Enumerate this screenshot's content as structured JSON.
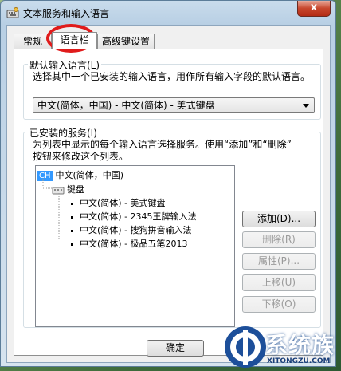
{
  "window": {
    "title": "文本服务和输入语言",
    "close_label": "x"
  },
  "tabs": [
    {
      "label": "常规"
    },
    {
      "label": "语言栏"
    },
    {
      "label": "高级键设置"
    }
  ],
  "default_group": {
    "label": "默认输入语言(L)",
    "description": "选择其中一个已安装的输入语言，用作所有输入字段的默认语言。",
    "selected": "中文(简体，中国) - 中文(简体) - 美式键盘"
  },
  "services_group": {
    "label": "已安装的服务(I)",
    "description_line1": "为列表中显示的每个输入语言选择服务。使用“添加”和“删除”",
    "description_line2": "按钮来修改这个列表。",
    "tree": {
      "language_badge": "CH",
      "language": "中文(简体，中国)",
      "category": "键盘",
      "items": [
        "中文(简体) - 美式键盘",
        "中文(简体) - 2345王牌输入法",
        "中文(简体) - 搜狗拼音输入法",
        "中文(简体) - 极品五笔2013"
      ]
    },
    "buttons": {
      "add": "添加(D)...",
      "remove": "删除(R)",
      "properties": "属性(P)...",
      "move_up": "上移(U)",
      "move_down": "下移(O)"
    }
  },
  "footer": {
    "ok": "确定"
  },
  "watermark": {
    "text": "系统族",
    "url": "XITONGZU.COM"
  },
  "colors": {
    "annotation_circle": "#e01b1b",
    "selection": "#3399ff"
  }
}
